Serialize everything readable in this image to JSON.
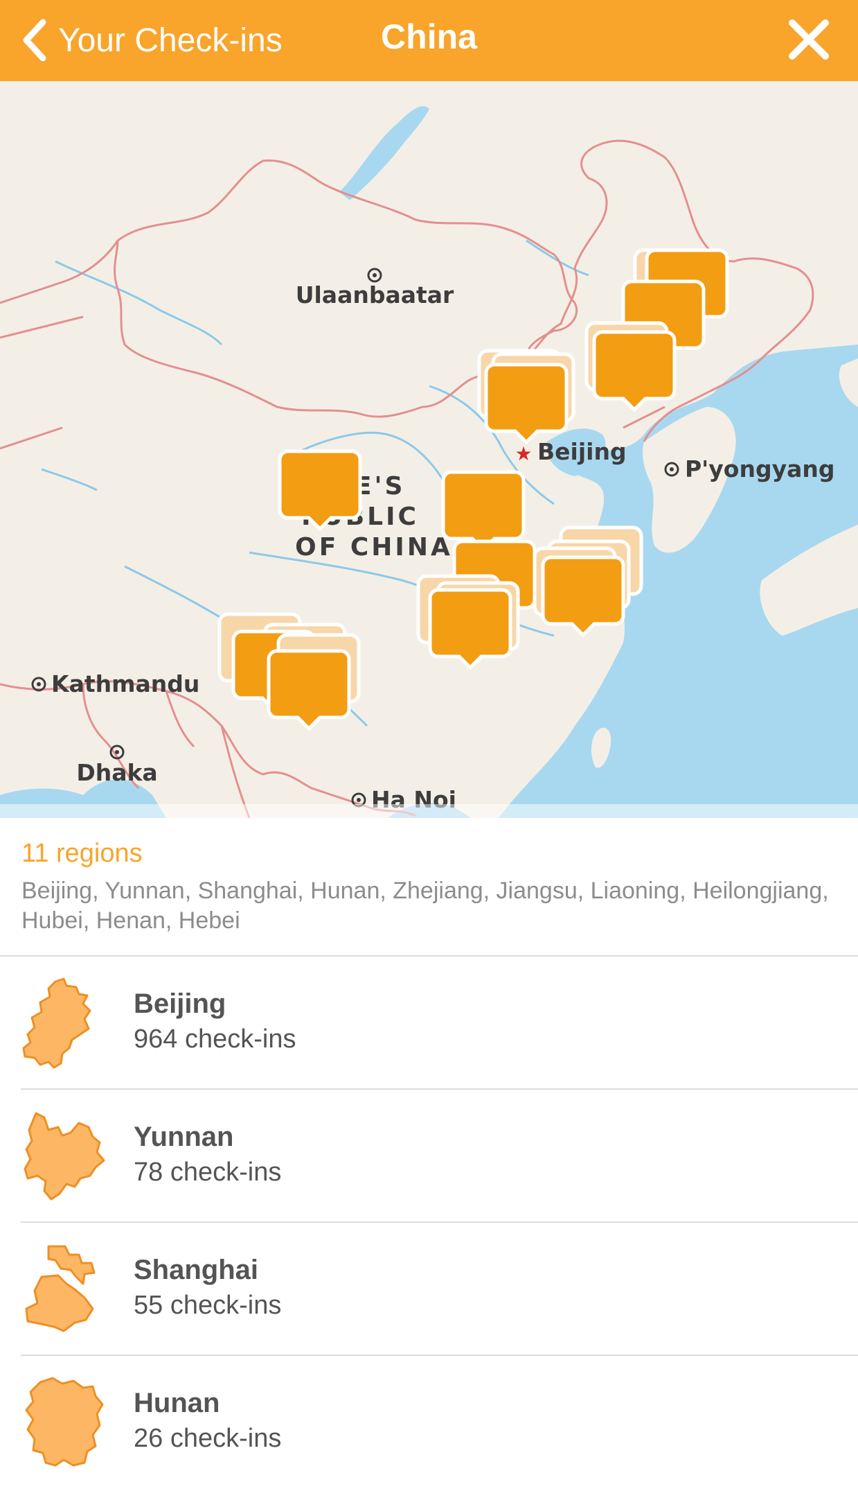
{
  "header": {
    "back_label": "Your Check-ins",
    "title": "China",
    "back_icon": "chevron-left-icon",
    "close_icon": "close-icon",
    "bar_color": "#f9a42b"
  },
  "map": {
    "labels": {
      "ulaanbaatar": "Ulaanbaatar",
      "beijing": "Beijing",
      "pyongyang": "P'yongyang",
      "country_line1": "PLE'S",
      "country_line2": "PUBLIC",
      "country_line3": "OF CHINA",
      "kathmandu": "Kathmandu",
      "dhaka": "Dhaka",
      "hanoi": "Ha Noi"
    },
    "marker_color": "#f29d12",
    "water_color": "#a8d8f0",
    "land_color": "#f4efe6"
  },
  "summary": {
    "count": "11 regions",
    "regions": "Beijing, Yunnan, Shanghai, Hunan, Zhejiang, Jiangsu, Liaoning, Heilongjiang, Hubei, Henan, Hebei"
  },
  "list": [
    {
      "name": "Beijing",
      "checkins": "964 check-ins"
    },
    {
      "name": "Yunnan",
      "checkins": "78 check-ins"
    },
    {
      "name": "Shanghai",
      "checkins": "55 check-ins"
    },
    {
      "name": "Hunan",
      "checkins": "26 check-ins"
    }
  ],
  "region_fill_color": "#fdb764",
  "region_stroke_color": "#ed8f23"
}
